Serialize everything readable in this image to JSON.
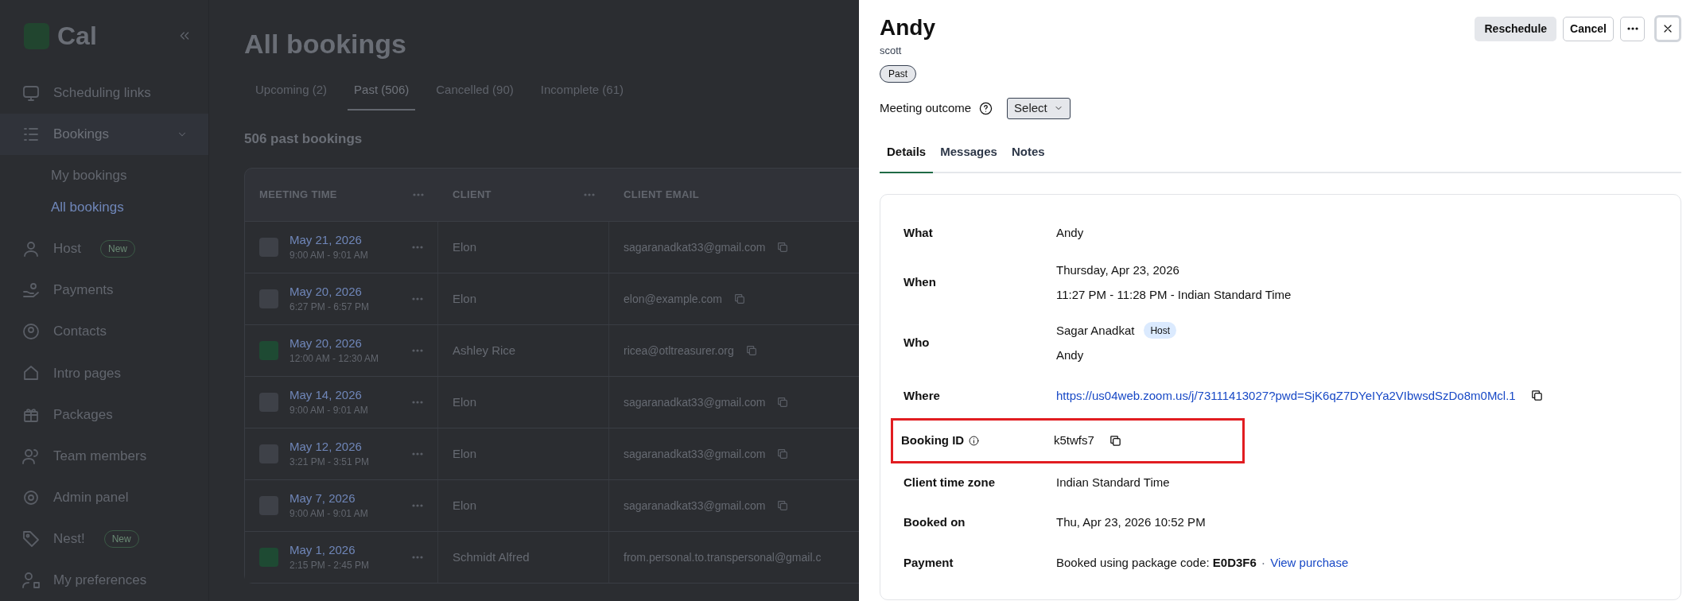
{
  "sidebar": {
    "logo": "Cal",
    "items": [
      {
        "label": "Scheduling links"
      },
      {
        "label": "Bookings",
        "expanded": true,
        "children": [
          {
            "label": "My bookings",
            "selected": false
          },
          {
            "label": "All bookings",
            "selected": true
          }
        ]
      },
      {
        "label": "Host",
        "badge": "New"
      },
      {
        "label": "Payments"
      },
      {
        "label": "Contacts"
      },
      {
        "label": "Intro pages"
      },
      {
        "label": "Packages"
      },
      {
        "label": "Team members"
      },
      {
        "label": "Admin panel"
      },
      {
        "label": "Nest!",
        "badge": "New"
      },
      {
        "label": "My preferences"
      }
    ]
  },
  "page": {
    "title": "All bookings",
    "tabs": [
      {
        "label": "Upcoming (2)",
        "selected": false
      },
      {
        "label": "Past (506)",
        "selected": true
      },
      {
        "label": "Cancelled (90)",
        "selected": false
      },
      {
        "label": "Incomplete (61)",
        "selected": false
      }
    ],
    "count": "506 past bookings",
    "table": {
      "columns": [
        "MEETING TIME",
        "CLIENT",
        "CLIENT EMAIL"
      ],
      "rows": [
        {
          "date": "May 21, 2026",
          "time": "9:00 AM - 9:01 AM",
          "client": "Elon",
          "email": "sagaranadkat33@gmail.com",
          "color": "#3e4148"
        },
        {
          "date": "May 20, 2026",
          "time": "6:27 PM - 6:57 PM",
          "client": "Elon",
          "email": "elon@example.com",
          "color": "#3e4148"
        },
        {
          "date": "May 20, 2026",
          "time": "12:00 AM - 12:30 AM",
          "client": "Ashley Rice",
          "email": "ricea@otltreasurer.org",
          "color": "#1e4a33"
        },
        {
          "date": "May 14, 2026",
          "time": "9:00 AM - 9:01 AM",
          "client": "Elon",
          "email": "sagaranadkat33@gmail.com",
          "color": "#3e4148"
        },
        {
          "date": "May 12, 2026",
          "time": "3:21 PM - 3:51 PM",
          "client": "Elon",
          "email": "sagaranadkat33@gmail.com",
          "color": "#3e4148"
        },
        {
          "date": "May 7, 2026",
          "time": "9:00 AM - 9:01 AM",
          "client": "Elon",
          "email": "sagaranadkat33@gmail.com",
          "color": "#3e4148"
        },
        {
          "date": "May 1, 2026",
          "time": "2:15 PM - 2:45 PM",
          "client": "Schmidt Alfred",
          "email": "from.personal.to.transpersonal@gmail.c",
          "color": "#1e4a33"
        }
      ]
    }
  },
  "panel": {
    "title": "Andy",
    "subtitle": "scott",
    "status": "Past",
    "buttons": [
      "Reschedule",
      "Cancel"
    ],
    "outcome": {
      "label": "Meeting outcome",
      "value": "Select"
    },
    "tabs": [
      {
        "label": "Details",
        "selected": true
      },
      {
        "label": "Messages",
        "selected": false
      },
      {
        "label": "Notes",
        "selected": false
      }
    ],
    "details": [
      {
        "label": "What",
        "kind": "text",
        "lines": [
          "Andy"
        ],
        "highlighted": false
      },
      {
        "label": "When",
        "kind": "text",
        "lines": [
          "Thursday, Apr 23, 2026",
          "11:27 PM - 11:28 PM - Indian Standard Time"
        ],
        "highlighted": false
      },
      {
        "label": "Who",
        "kind": "people",
        "lines": [
          "Sagar Anadkat",
          "Andy"
        ],
        "badge": "Host",
        "highlighted": false
      },
      {
        "label": "Where",
        "kind": "link",
        "lines": [
          "https://us04web.zoom.us/j/73111413027?pwd=SjK6qZ7DYeIYa2VIbwsdSzDo8m0Mcl.1"
        ],
        "copy": true,
        "highlighted": false
      },
      {
        "label": "Booking ID",
        "kind": "text",
        "lines": [
          "k5twfs7"
        ],
        "copy": true,
        "info": true,
        "highlighted": true
      },
      {
        "label": "Client time zone",
        "kind": "text",
        "lines": [
          "Indian Standard Time"
        ],
        "highlighted": false
      },
      {
        "label": "Booked on",
        "kind": "text",
        "lines": [
          "Thu, Apr 23, 2026 10:52 PM"
        ],
        "highlighted": false
      },
      {
        "label": "Payment",
        "kind": "payment",
        "lines": [
          "Booked using package code: **E0D3F6**"
        ],
        "separator": "·",
        "link": "View purchase",
        "highlighted": false
      }
    ]
  }
}
